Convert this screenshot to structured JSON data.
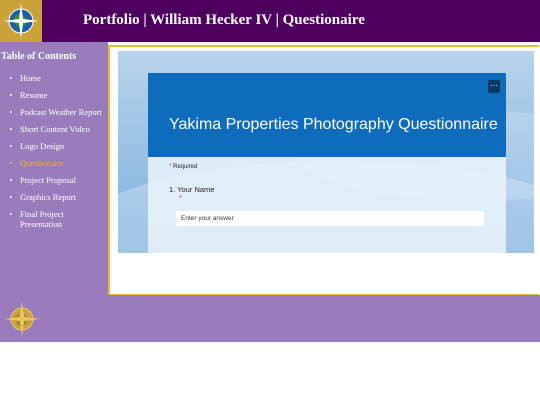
{
  "header": {
    "title": "Portfolio | William Hecker IV | Questionaire",
    "logo_icon": "globe-compass-icon"
  },
  "sidebar": {
    "title": "Table of Contents",
    "items": [
      {
        "label": "Home"
      },
      {
        "label": "Resume"
      },
      {
        "label": "Podcast Weather Report"
      },
      {
        "label": "Short Content Video"
      },
      {
        "label": "Logo Design"
      },
      {
        "label": "Questionaire",
        "active": true
      },
      {
        "label": "Project Proposal"
      },
      {
        "label": "Graphics Report"
      },
      {
        "label": "Final Project Presentation"
      }
    ]
  },
  "form": {
    "title": "Yakima Properties Photography Questionnaire",
    "more_label": "···",
    "required_text": "Required",
    "required_marker": "*",
    "question_1": {
      "label": "1. Your Name",
      "required_marker": "*",
      "placeholder": "Enter your answer"
    }
  },
  "colors": {
    "header_bg": "#4e005f",
    "sidebar_bg": "#9a7bbb",
    "accent_gold": "#e8b93a",
    "active_link": "#f0b323",
    "form_header": "#0f6cbd"
  },
  "footer": {
    "logo_icon": "globe-compass-icon"
  }
}
